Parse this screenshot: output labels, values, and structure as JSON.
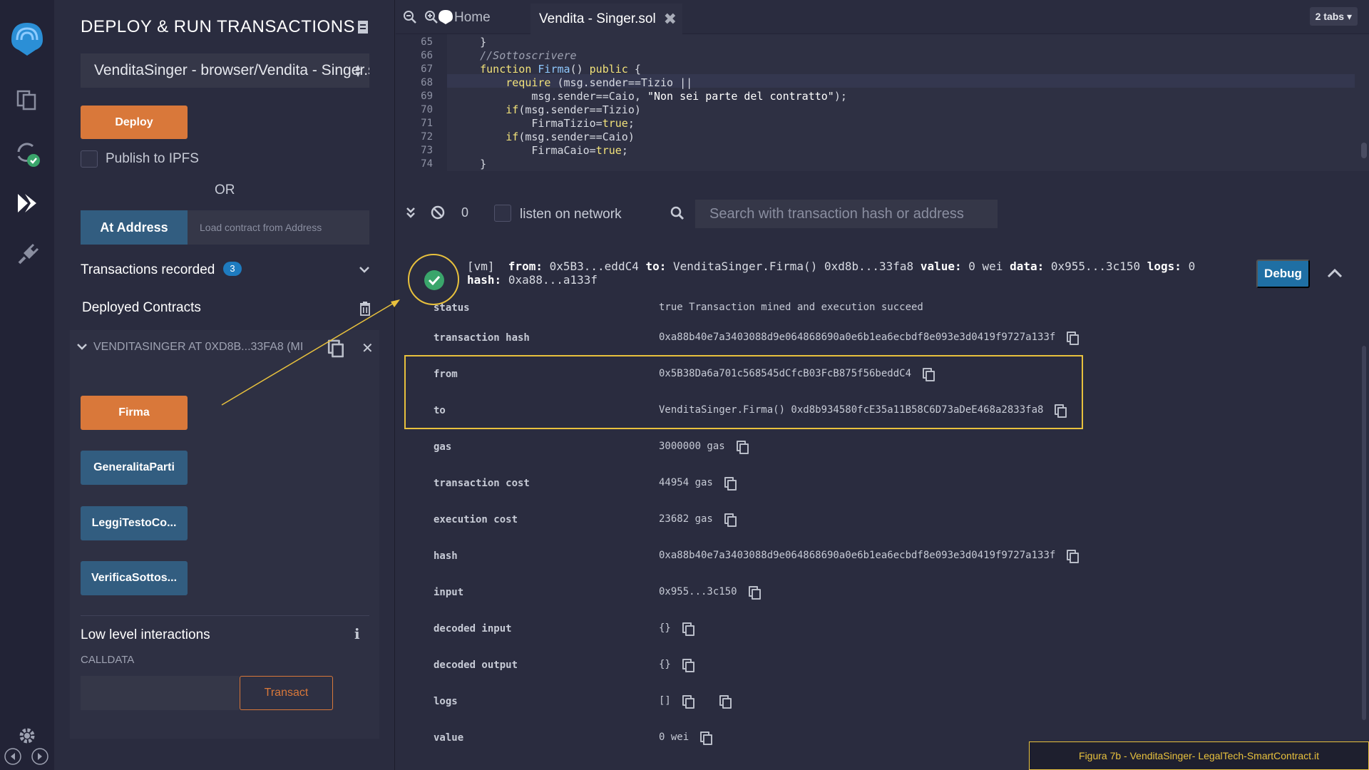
{
  "sidebar": {
    "title": "DEPLOY & RUN TRANSACTIONS",
    "contract_select": "VenditaSinger - browser/Vendita - Singer.sol",
    "deploy_label": "Deploy",
    "publish_label": "Publish to IPFS",
    "or_label": "OR",
    "at_address_label": "At Address",
    "at_address_placeholder": "Load contract from Address",
    "transactions_label": "Transactions recorded",
    "transactions_count": "3",
    "deployed_label": "Deployed Contracts",
    "instance_label": "VENDITASINGER AT 0XD8B...33FA8 (MI",
    "functions": [
      {
        "label": "Firma",
        "color": "orange"
      },
      {
        "label": "GeneralitaParti",
        "color": "blue"
      },
      {
        "label": "LeggiTestoCo...",
        "color": "blue"
      },
      {
        "label": "VerificaSottos...",
        "color": "blue"
      }
    ],
    "low_level_label": "Low level interactions",
    "calldata_label": "CALLDATA",
    "transact_label": "Transact"
  },
  "editor": {
    "home_tab": "Home",
    "active_tab": "Vendita - Singer.sol",
    "tabs_count": "2 tabs",
    "line_numbers": [
      "65",
      "66",
      "67",
      "68",
      "69",
      "70",
      "71",
      "72",
      "73",
      "74"
    ],
    "code": [
      "    }",
      "    //Sottoscrivere",
      "    function Firma() public {",
      "        require (msg.sender==Tizio ||",
      "            msg.sender==Caio, \"Non sei parte del contratto\");",
      "        if(msg.sender==Tizio)",
      "            FirmaTizio=true;",
      "        if(msg.sender==Caio)",
      "            FirmaCaio=true;",
      "    }"
    ]
  },
  "terminal": {
    "pending_count": "0",
    "listen_label": "listen on network",
    "search_placeholder": "Search with transaction hash or address"
  },
  "transaction": {
    "head_vm": "[vm]",
    "head_from_label": "from:",
    "head_from": "0x5B3...eddC4",
    "head_to_label": "to:",
    "head_to": "VenditaSinger.Firma() 0xd8b...33fa8",
    "head_value_label": "value:",
    "head_value": "0 wei",
    "head_data_label": "data:",
    "head_data": "0x955...3c150",
    "head_logs_label": "logs:",
    "head_logs": "0",
    "head_hash_label": "hash:",
    "head_hash": "0xa88...a133f",
    "debug_label": "Debug",
    "rows": [
      {
        "key": "status",
        "value": "true Transaction mined and execution succeed",
        "copy": false
      },
      {
        "key": "transaction hash",
        "value": "0xa88b40e7a3403088d9e064868690a0e6b1ea6ecbdf8e093e3d0419f9727a133f",
        "copy": true
      },
      {
        "key": "from",
        "value": "0x5B38Da6a701c568545dCfcB03FcB875f56beddC4",
        "copy": true
      },
      {
        "key": "to",
        "value": "VenditaSinger.Firma() 0xd8b934580fcE35a11B58C6D73aDeE468a2833fa8",
        "copy": true
      },
      {
        "key": "gas",
        "value": "3000000 gas",
        "copy": true
      },
      {
        "key": "transaction cost",
        "value": "44954 gas",
        "copy": true
      },
      {
        "key": "execution cost",
        "value": "23682 gas",
        "copy": true
      },
      {
        "key": "hash",
        "value": "0xa88b40e7a3403088d9e064868690a0e6b1ea6ecbdf8e093e3d0419f9727a133f",
        "copy": true
      },
      {
        "key": "input",
        "value": "0x955...3c150",
        "copy": true
      },
      {
        "key": "decoded input",
        "value": "{}",
        "copy": true
      },
      {
        "key": "decoded output",
        "value": "{}",
        "copy": true
      },
      {
        "key": "logs",
        "value": "[]",
        "copy": true,
        "double_copy": true
      },
      {
        "key": "value",
        "value": "0 wei",
        "copy": true
      }
    ]
  },
  "caption": "Figura 7b - VenditaSinger- LegalTech-SmartContract.it",
  "colors": {
    "accent_orange": "#d9783a",
    "accent_blue": "#325d80",
    "highlight": "#e8c13d",
    "success": "#3aa56b"
  }
}
